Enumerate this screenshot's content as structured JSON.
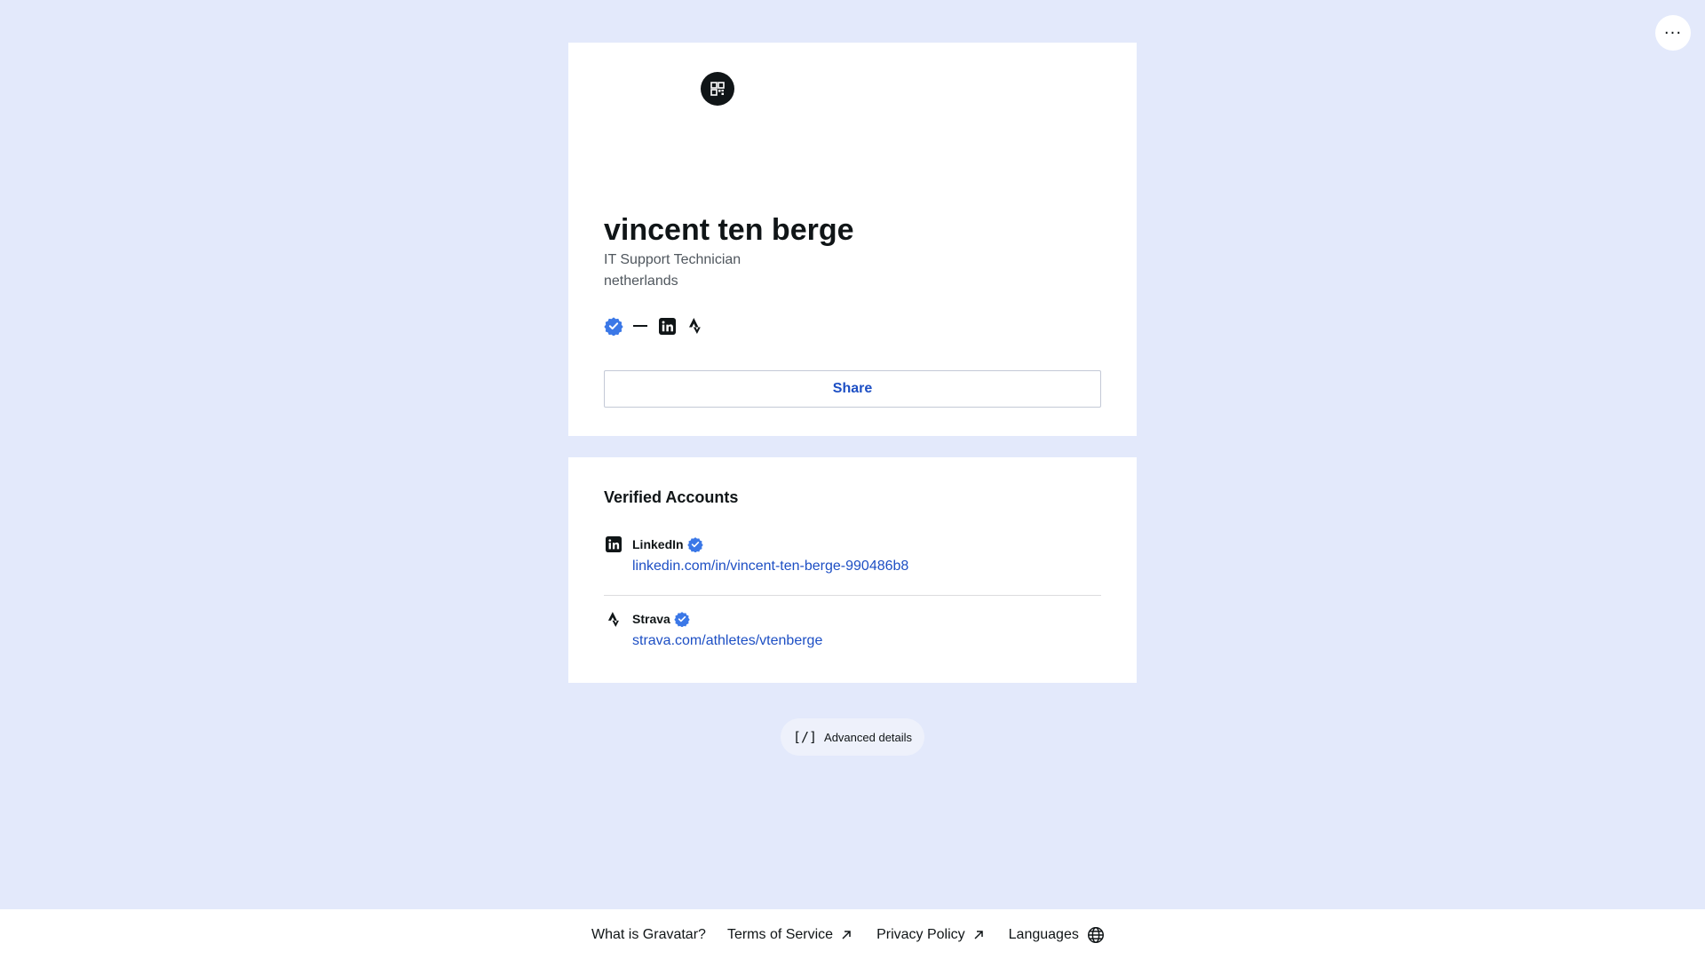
{
  "header": {
    "more_label": "···"
  },
  "profile": {
    "name": "vincent ten berge",
    "job_title": "IT Support Technician",
    "location": "netherlands",
    "share_label": "Share"
  },
  "verified": {
    "title": "Verified Accounts",
    "accounts": [
      {
        "name": "LinkedIn",
        "url": "linkedin.com/in/vincent-ten-berge-990486b8",
        "icon": "linkedin-icon"
      },
      {
        "name": "Strava",
        "url": "strava.com/athletes/vtenberge",
        "icon": "strava-icon"
      }
    ]
  },
  "advanced": {
    "icon_text": "[/]",
    "label": "Advanced details"
  },
  "footer": {
    "links": [
      {
        "label": "What is Gravatar?",
        "icon": ""
      },
      {
        "label": "Terms of Service",
        "icon": "external-arrow-icon"
      },
      {
        "label": "Privacy Policy",
        "icon": "external-arrow-icon"
      },
      {
        "label": "Languages",
        "icon": "globe-icon"
      }
    ]
  },
  "colors": {
    "background": "#e3e9fb",
    "link": "#1d4fc4",
    "verified_badge": "#3b78e7",
    "text": "#101517"
  }
}
